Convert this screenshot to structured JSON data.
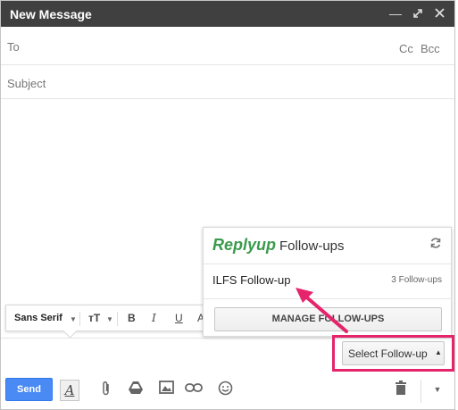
{
  "window": {
    "title": "New Message"
  },
  "title_icons": [
    "minimize-icon",
    "maximize-icon",
    "close-icon"
  ],
  "compose": {
    "to_label": "To",
    "cc_label": "Cc",
    "bcc_label": "Bcc",
    "subject_placeholder": "Subject"
  },
  "formatting": {
    "font": "Sans Serif",
    "bold": "B",
    "italic": "I",
    "underline": "U",
    "text_color": "A",
    "size_icon": "тT"
  },
  "replyup": {
    "brand": "Replyup",
    "heading": "Follow-ups",
    "item_name": "ILFS Follow-up",
    "item_count": "3 Follow-ups",
    "manage_button": "MANAGE FOLLOW-UPS",
    "select_button": "Select Follow-up",
    "brand_color": "#3a9b4c"
  },
  "toolbar": {
    "send": "Send",
    "format_toggle": "A"
  },
  "colors": {
    "accent": "#4a8af4",
    "highlight": "#e5246b",
    "titlebar": "#404040"
  }
}
